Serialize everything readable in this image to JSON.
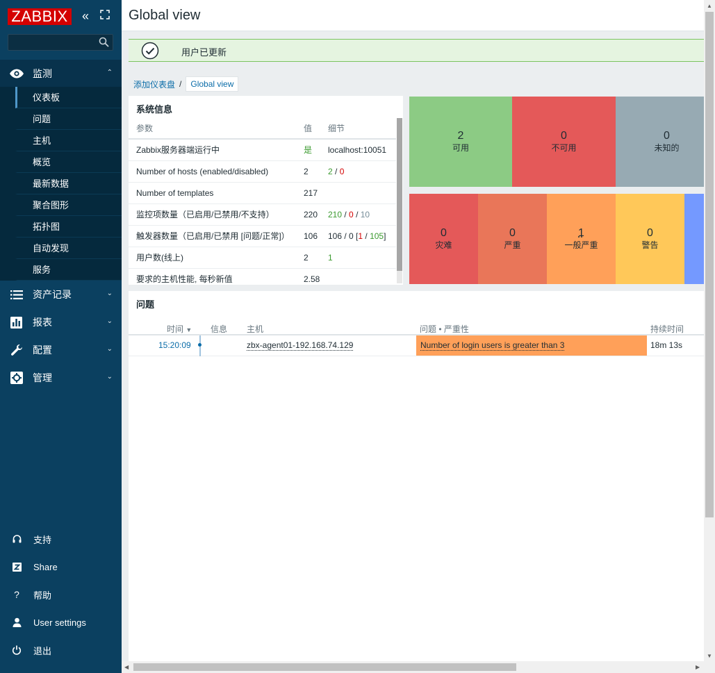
{
  "sidebar": {
    "logo": "ZABBIX",
    "collapse_icon": "«",
    "kiosk_icon": "⛶",
    "menu_monitoring": "监测",
    "monitoring_items": [
      {
        "label": "仪表板"
      },
      {
        "label": "问题"
      },
      {
        "label": "主机"
      },
      {
        "label": "概览"
      },
      {
        "label": "最新数据"
      },
      {
        "label": "聚合图形"
      },
      {
        "label": "拓扑图"
      },
      {
        "label": "自动发现"
      },
      {
        "label": "服务"
      }
    ],
    "menu_inventory": "资产记录",
    "menu_reports": "报表",
    "menu_config": "配置",
    "menu_admin": "管理",
    "bottom": {
      "support": "支持",
      "share": "Share",
      "help": "帮助",
      "user_settings": "User settings",
      "logout": "退出"
    }
  },
  "header": {
    "title": "Global view"
  },
  "message": {
    "text": "用户已更新"
  },
  "breadcrumb": {
    "parent": "添加仪表盘",
    "separator": "/",
    "current": "Global view"
  },
  "system_info": {
    "title": "系统信息",
    "columns": {
      "param": "参数",
      "value": "值",
      "details": "细节"
    },
    "rows": [
      {
        "param": "Zabbix服务器端运行中",
        "value": "是",
        "d1": "localhost:10051"
      },
      {
        "param": "Number of hosts (enabled/disabled)",
        "value": "2",
        "d1": "2",
        "s1": " / ",
        "d2": "0"
      },
      {
        "param": "Number of templates",
        "value": "217"
      },
      {
        "param": "监控项数量（已启用/已禁用/不支持）",
        "value": "220",
        "d1": "210",
        "s1": " / ",
        "d2": "0",
        "s2": " / ",
        "d3": "10"
      },
      {
        "param": "触发器数量（已启用/已禁用 [问题/正常]）",
        "value": "106",
        "d1": "106 / 0 [",
        "d2": "1",
        "s2": " / ",
        "d3": "105",
        "s3": "]"
      },
      {
        "param": "用户数(线上)",
        "value": "2",
        "d1": "1"
      },
      {
        "param": "要求的主机性能, 每秒新值",
        "value": "2.58"
      }
    ]
  },
  "host_availability": [
    {
      "count": "2",
      "label": "可用",
      "color": "#8ccb84"
    },
    {
      "count": "0",
      "label": "不可用",
      "color": "#e45959"
    },
    {
      "count": "0",
      "label": "未知的",
      "color": "#97aab3"
    }
  ],
  "severity": [
    {
      "count": "0",
      "label": "灾难",
      "color": "#e45959"
    },
    {
      "count": "0",
      "label": "严重",
      "color": "#e97659"
    },
    {
      "count": "1",
      "label": "一般严重",
      "color": "#ffa059"
    },
    {
      "count": "0",
      "label": "警告",
      "color": "#ffc859"
    },
    {
      "count": "",
      "label": "",
      "color": "#7499ff"
    }
  ],
  "problems": {
    "title": "问题",
    "columns": {
      "time": "时间",
      "sort_icon": "▼",
      "info": "信息",
      "host": "主机",
      "problem": "问题 • 严重性",
      "duration": "持续时间"
    },
    "rows": [
      {
        "time": "15:20:09",
        "host": "zbx-agent01-192.168.74.129",
        "problem": "Number of login users is greater than 3",
        "duration": "18m 13s"
      }
    ]
  }
}
